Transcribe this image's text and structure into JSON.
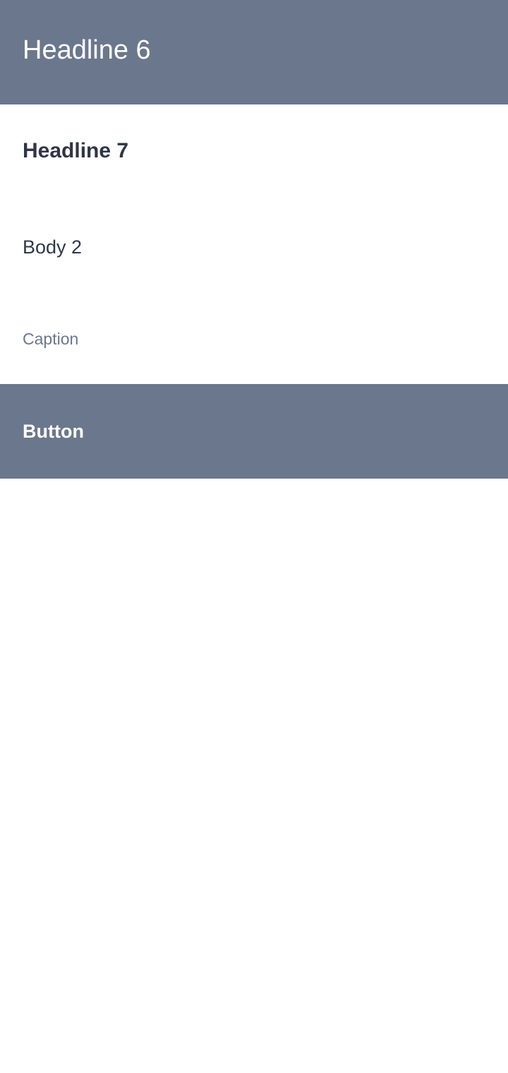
{
  "header": {
    "title": "Headline 6"
  },
  "typography": {
    "headline7": "Headline 7",
    "body2": "Body 2",
    "caption": "Caption"
  },
  "button": {
    "label": "Button"
  },
  "colors": {
    "primary": "#6b778c",
    "text_dark": "#2e3546",
    "background": "#ffffff"
  }
}
